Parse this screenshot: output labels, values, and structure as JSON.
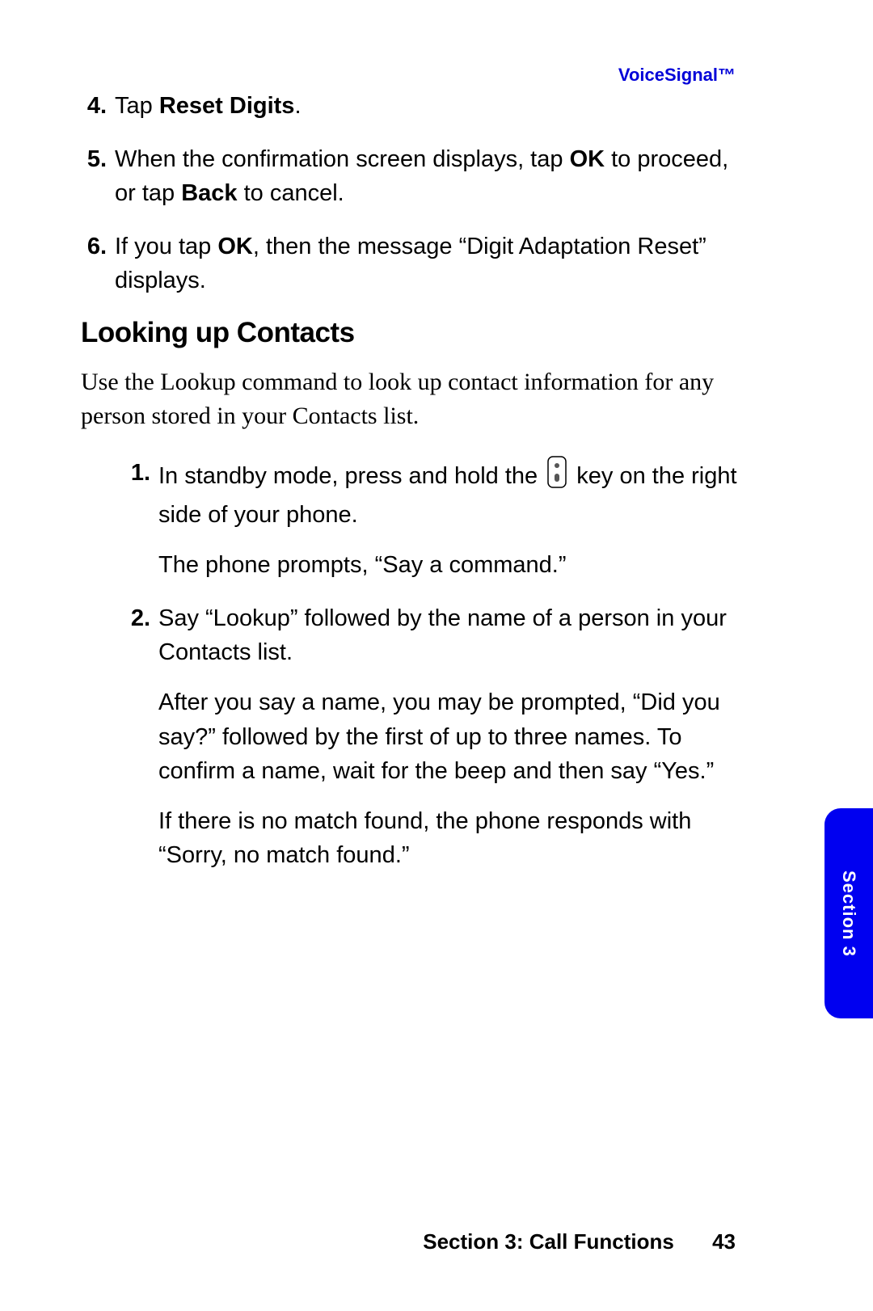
{
  "header": {
    "link": "VoiceSignal™"
  },
  "steps_top": [
    {
      "num": "4.",
      "pre": "Tap ",
      "bold": "Reset Digits",
      "post": "."
    },
    {
      "num": "5.",
      "textHtml": "When the confirmation screen displays, tap <b>OK</b> to proceed, or tap <b>Back</b> to cancel."
    },
    {
      "num": "6.",
      "textHtml": "If you tap <b>OK</b>, then the message “Digit Adaptation Reset” displays."
    }
  ],
  "section": {
    "heading": "Looking up Contacts",
    "intro": "Use the Lookup command to look up contact information for any person stored in your Contacts list."
  },
  "steps_sub": [
    {
      "num": "1.",
      "line1_a": "In standby mode, press and hold the ",
      "line1_b": " key on the right side of your phone.",
      "line2": "The phone prompts, “Say a command.”"
    },
    {
      "num": "2.",
      "line1": "Say “Lookup” followed by the name of a person in your Contacts list.",
      "line2": "After you say a name, you may be prompted, “Did you say?” followed by the first of up to three names. To confirm a name, wait for the beep and then say “Yes.”",
      "line3": "If there is no match found, the phone responds with “Sorry, no match found.”"
    }
  ],
  "footer": {
    "section": "Section 3: Call Functions",
    "page": "43"
  },
  "sidetab": {
    "label": "Section 3"
  }
}
